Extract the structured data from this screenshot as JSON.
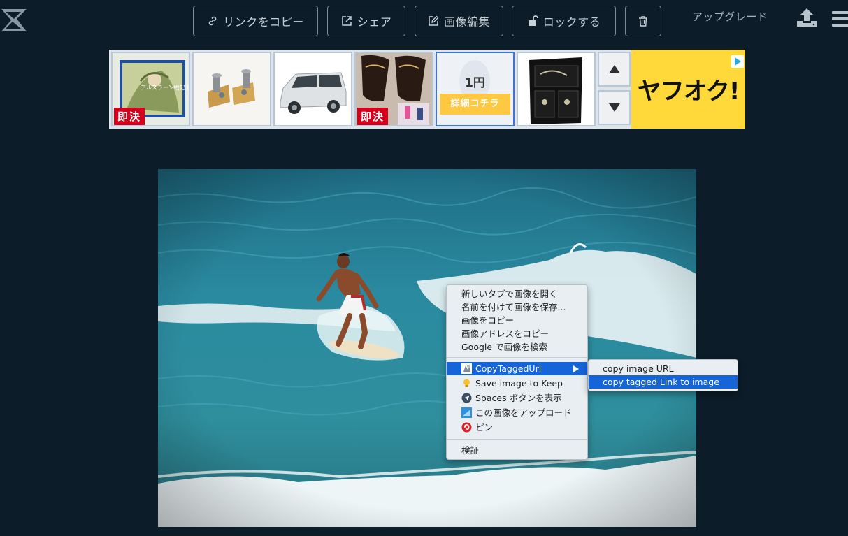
{
  "toolbar": {
    "copy_link_label": "リンクをコピー",
    "share_label": "シェア",
    "edit_image_label": "画像編集",
    "lock_label": "ロックする",
    "upgrade_label": "アップグレード"
  },
  "ads": {
    "tiles": [
      {
        "badge": "即決",
        "image_text": "アルスラーン戦記 風塵乱舞"
      },
      {
        "badge": ""
      },
      {
        "badge": ""
      },
      {
        "badge": "即決"
      },
      {
        "price": "1円",
        "button": "詳細コチラ"
      },
      {
        "badge": ""
      }
    ],
    "brand": "ヤフオク!"
  },
  "context_menu": {
    "items": [
      {
        "label": "新しいタブで画像を開く"
      },
      {
        "label": "名前を付けて画像を保存..."
      },
      {
        "label": "画像をコピー"
      },
      {
        "label": "画像アドレスをコピー"
      },
      {
        "label": "Google で画像を検索"
      },
      {
        "label": "CopyTaggedUrl",
        "icon": "extension-icon"
      },
      {
        "label": "Save image to Keep",
        "icon": "keep-bulb-icon"
      },
      {
        "label": "Spaces ボタンを表示",
        "icon": "spaces-icon"
      },
      {
        "label": "この画像をアップロード",
        "icon": "upload-image-icon"
      },
      {
        "label": "ピン",
        "icon": "pinterest-icon"
      },
      {
        "label": "検証"
      }
    ],
    "submenu": [
      {
        "label": "copy image URL"
      },
      {
        "label": "copy tagged Link to image"
      }
    ]
  },
  "colors": {
    "background": "#0c1c28",
    "highlight": "#1565d8",
    "yahuoku": "#ffd93a",
    "badge": "#d6001c"
  }
}
